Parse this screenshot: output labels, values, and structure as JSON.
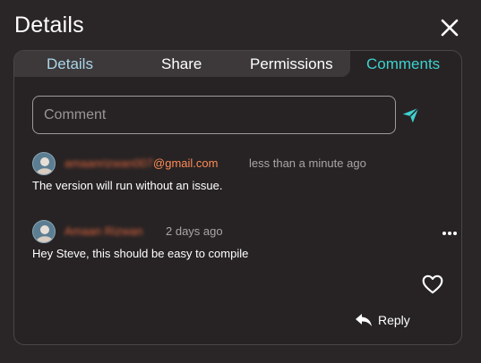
{
  "header": {
    "title": "Details"
  },
  "tabs": {
    "details": "Details",
    "share": "Share",
    "permissions": "Permissions",
    "comments": "Comments",
    "active": "Comments"
  },
  "composer": {
    "placeholder": "Comment"
  },
  "comments": [
    {
      "author_blurred": "amaanrizwan007",
      "author_domain": "@gmail.com",
      "time": "less than a minute ago",
      "text": "The version will run without an issue."
    },
    {
      "author_blurred": "Amaan Rizwan",
      "time": "2 days ago",
      "text": "Hey Steve, this should be easy to compile"
    }
  ],
  "actions": {
    "reply_label": "Reply"
  },
  "colors": {
    "background": "#2a2627",
    "active_tab": "#3fd0d0",
    "details_tab": "#a9d6ea",
    "author": "#ff8a55",
    "send": "#3fd0d0"
  },
  "icons": [
    "close-icon",
    "send-icon",
    "more-icon",
    "heart-icon",
    "reply-icon",
    "avatar-icon"
  ]
}
